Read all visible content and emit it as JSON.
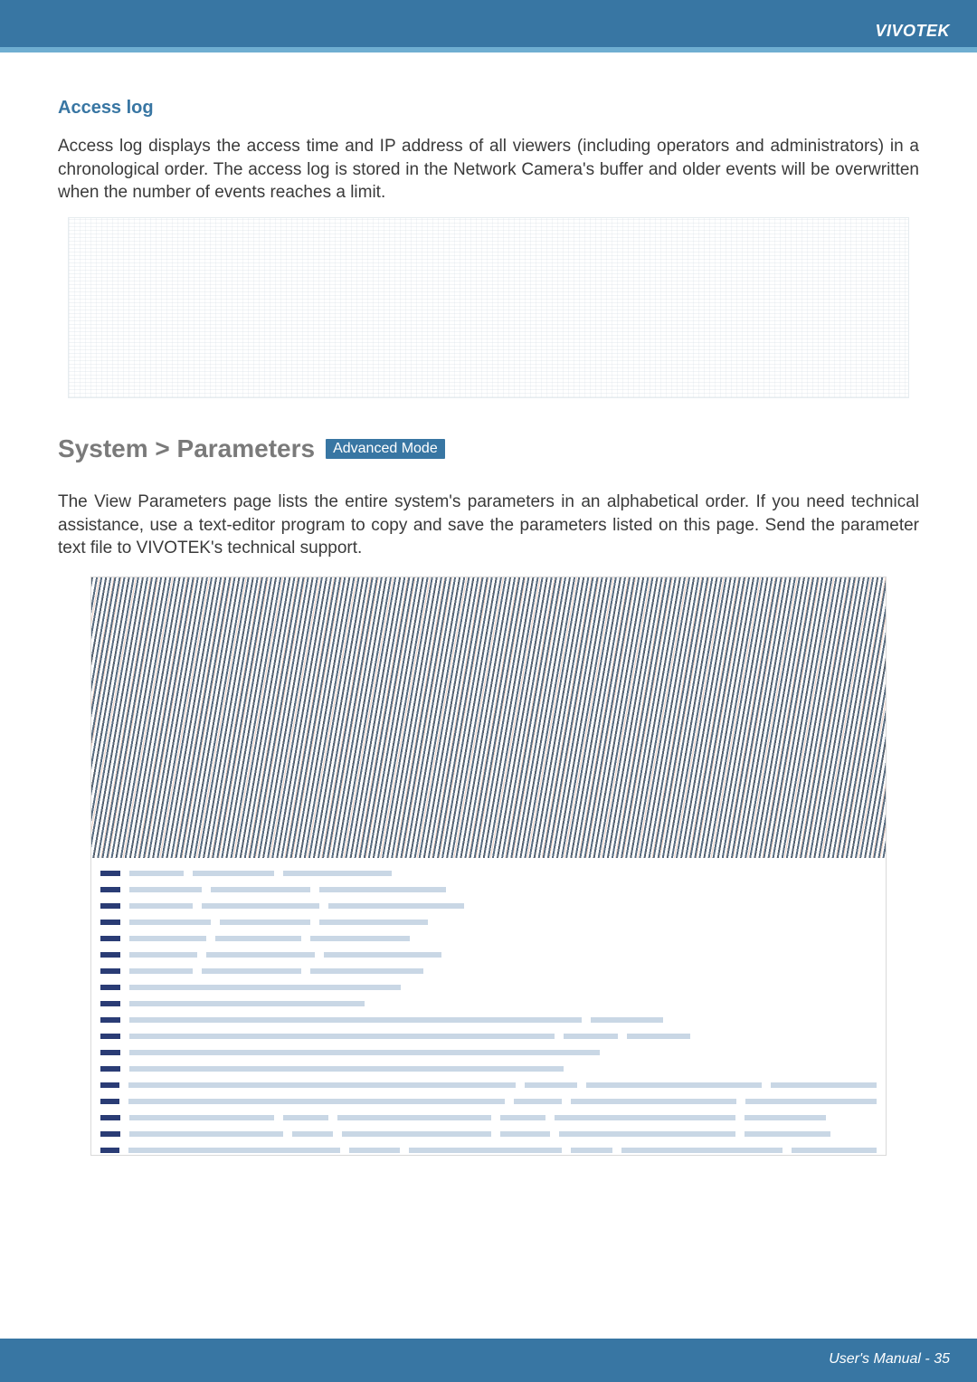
{
  "header": {
    "brand": "VIVOTEK"
  },
  "sections": {
    "access_log": {
      "title": "Access log",
      "paragraph": "Access log displays the access time and IP address of all viewers (including operators and administrators) in a chronological order. The access log is stored in the Network Camera's buffer and older events will be overwritten when the number of events reaches a limit."
    },
    "parameters": {
      "breadcrumb": "System > Parameters",
      "badge": "Advanced Mode",
      "paragraph": "The View Parameters page lists the entire system's parameters in an alphabetical order. If you need technical assistance, use a text-editor program to copy and save the parameters listed on this page. Send the parameter text file to VIVOTEK's technical support."
    }
  },
  "footer": {
    "label": "User's Manual - 35"
  },
  "param_rows": [
    [
      60,
      90,
      120
    ],
    [
      80,
      110,
      140
    ],
    [
      70,
      130,
      150
    ],
    [
      90,
      100,
      120
    ],
    [
      85,
      95,
      110
    ],
    [
      75,
      120,
      130
    ],
    [
      70,
      110,
      125
    ],
    [
      300
    ],
    [
      260
    ],
    [
      500,
      80
    ],
    [
      470,
      60,
      70
    ],
    [
      520
    ],
    [
      480
    ],
    [
      440,
      60,
      200,
      120
    ],
    [
      430,
      55,
      190,
      150
    ],
    [
      160,
      50,
      170,
      50,
      200,
      90
    ],
    [
      170,
      45,
      165,
      55,
      195,
      95
    ],
    [
      250,
      60,
      180,
      50,
      190,
      100
    ]
  ]
}
